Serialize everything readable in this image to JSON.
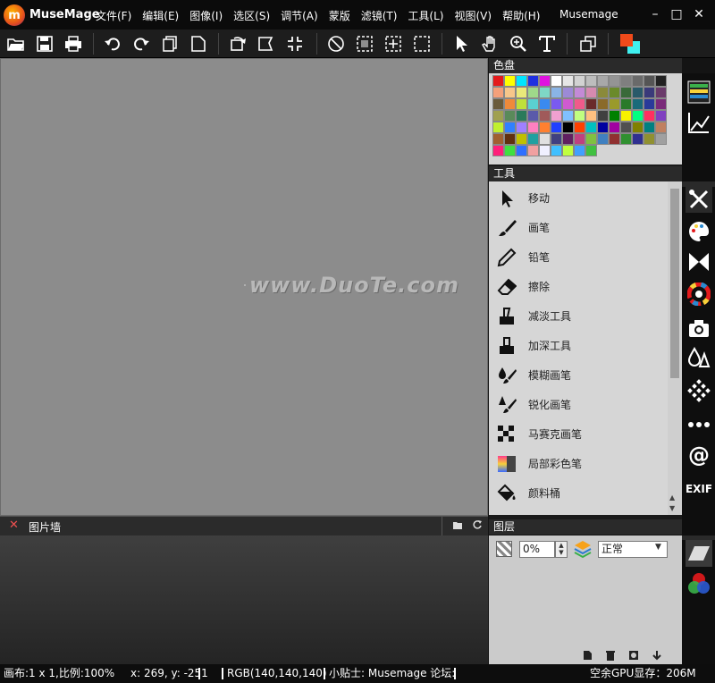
{
  "app": {
    "name": "MuseMage",
    "window_title": "Musemage",
    "logo_letter": "m"
  },
  "menu": [
    "文件(F)",
    "编辑(E)",
    "图像(I)",
    "选区(S)",
    "调节(A)",
    "蒙版",
    "滤镜(T)",
    "工具(L)",
    "视图(V)",
    "帮助(H)"
  ],
  "window_buttons": {
    "minimize": "–",
    "maximize": "□",
    "close": "✕"
  },
  "canvas": {
    "watermark": "www.DuoTe.com",
    "background": "#8c8c8c"
  },
  "picture_wall": {
    "title": "图片墙",
    "close": "✕"
  },
  "palette": {
    "title": "色盘",
    "colors": [
      "#e41a1c",
      "#ffff00",
      "#00e5ff",
      "#1f2fe0",
      "#e012e0",
      "#ffffff",
      "#e6e6e6",
      "#d2d2d2",
      "#bdbdbd",
      "#a8a8a8",
      "#949494",
      "#7f7f7f",
      "#6a6a6a",
      "#555555",
      "#222222",
      "#f4a07a",
      "#f7c68a",
      "#e9e97a",
      "#9fd88a",
      "#7ed7c6",
      "#8ab4e6",
      "#9c8ad6",
      "#c38ad6",
      "#d68ab0",
      "#8a8a3a",
      "#6a8a2a",
      "#3a6a3a",
      "#2a5a6a",
      "#3a3a7a",
      "#6a3a6a",
      "#6a5a3a",
      "#f08a3a",
      "#bfe03a",
      "#5ad0d0",
      "#3a8af0",
      "#7a5af0",
      "#d05ad0",
      "#f05a8a",
      "#6a2a2a",
      "#8a6a2a",
      "#9a9a2a",
      "#2a7a2a",
      "#1a6a7a",
      "#2a3a9a",
      "#7a2a7a",
      "#a0a050",
      "#5a8a5a",
      "#2a7a5a",
      "#5a5aaa",
      "#a05a5a",
      "#f0a0d0",
      "#80c0ff",
      "#c0ff80",
      "#ffc080",
      "#404040",
      "#008000",
      "#f7f200",
      "#00ff80",
      "#ff3060",
      "#8040c0",
      "#c0f030",
      "#3080ff",
      "#a080ff",
      "#ff80c0",
      "#ff8030",
      "#2040ff",
      "#000000",
      "#ff4000",
      "#00c0c0",
      "#0000a0",
      "#a000a0",
      "#505050",
      "#808000",
      "#008080",
      "#c08060",
      "#a06030",
      "#603010",
      "#c0c000",
      "#20a0a0",
      "#e0e0e0",
      "#404080",
      "#602060",
      "#c04080",
      "#80c040",
      "#4080c0",
      "#903030",
      "#309030",
      "#303090",
      "#909030",
      "#a0a0a0",
      "#ff1f7a",
      "#3fe03f",
      "#2f6fff",
      "#f0a0a0",
      "#f0f0ff",
      "#40c0ff",
      "#c0ff40",
      "#40a0ff",
      "#40c040"
    ]
  },
  "tools_panel": {
    "title": "工具",
    "items": [
      {
        "label": "移动",
        "icon": "move-cursor-icon"
      },
      {
        "label": "画笔",
        "icon": "brush-icon"
      },
      {
        "label": "铅笔",
        "icon": "pencil-icon"
      },
      {
        "label": "擦除",
        "icon": "eraser-icon"
      },
      {
        "label": "减淡工具",
        "icon": "dodge-icon"
      },
      {
        "label": "加深工具",
        "icon": "burn-icon"
      },
      {
        "label": "模糊画笔",
        "icon": "blur-brush-icon"
      },
      {
        "label": "锐化画笔",
        "icon": "sharpen-brush-icon"
      },
      {
        "label": "马赛克画笔",
        "icon": "mosaic-brush-icon"
      },
      {
        "label": "局部彩色笔",
        "icon": "local-color-brush-icon"
      },
      {
        "label": "颜料桶",
        "icon": "paint-bucket-icon"
      }
    ]
  },
  "layers_panel": {
    "title": "图层",
    "opacity": "0%",
    "blend_mode": "正常"
  },
  "sidebar": {
    "exif_label": "EXIF"
  },
  "status": {
    "canvas_info": "画布:1 x 1,比例:100%",
    "coords": "x: 269, y: -251",
    "rgb": "RGB(140,140,140)",
    "tip": "小贴士: Musemage 论坛:",
    "gpu": "空余GPU显存：206M"
  }
}
